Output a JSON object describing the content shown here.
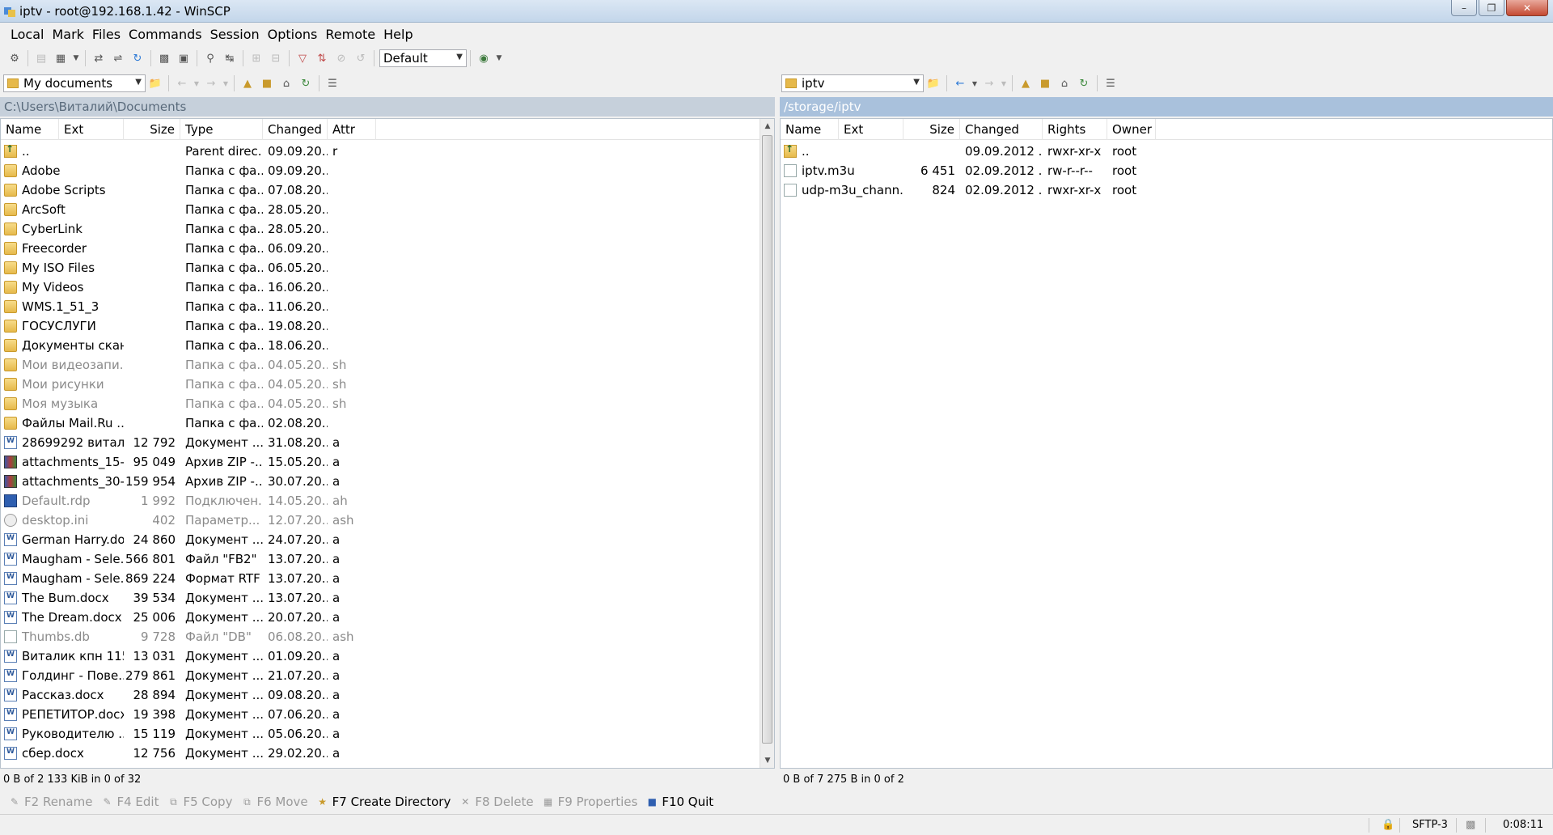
{
  "window": {
    "title": "iptv - root@192.168.1.42 - WinSCP"
  },
  "menu": [
    {
      "label": "Local"
    },
    {
      "label": "Mark"
    },
    {
      "label": "Files"
    },
    {
      "label": "Commands"
    },
    {
      "label": "Session"
    },
    {
      "label": "Options"
    },
    {
      "label": "Remote"
    },
    {
      "label": "Help"
    }
  ],
  "toolbar": {
    "profile_value": "Default"
  },
  "left": {
    "location": "My documents",
    "path": "C:\\Users\\Виталий\\Documents",
    "columns": [
      "Name",
      "Ext",
      "Size",
      "Type",
      "Changed",
      "Attr"
    ],
    "rows": [
      {
        "name": "..",
        "size": "",
        "type": "Parent direc...",
        "changed": "09.09.20...",
        "attr": "r",
        "icon": "up-folder-icon"
      },
      {
        "name": "Adobe",
        "size": "",
        "type": "Папка с фа...",
        "changed": "09.09.20...",
        "attr": "",
        "icon": "folder-icon"
      },
      {
        "name": "Adobe Scripts",
        "size": "",
        "type": "Папка с фа...",
        "changed": "07.08.20...",
        "attr": "",
        "icon": "folder-icon"
      },
      {
        "name": "ArcSoft",
        "size": "",
        "type": "Папка с фа...",
        "changed": "28.05.20...",
        "attr": "",
        "icon": "folder-icon"
      },
      {
        "name": "CyberLink",
        "size": "",
        "type": "Папка с фа...",
        "changed": "28.05.20...",
        "attr": "",
        "icon": "folder-icon"
      },
      {
        "name": "Freecorder",
        "size": "",
        "type": "Папка с фа...",
        "changed": "06.09.20...",
        "attr": "",
        "icon": "folder-icon"
      },
      {
        "name": "My ISO Files",
        "size": "",
        "type": "Папка с фа...",
        "changed": "06.05.20...",
        "attr": "",
        "icon": "folder-icon"
      },
      {
        "name": "My Videos",
        "size": "",
        "type": "Папка с фа...",
        "changed": "16.06.20...",
        "attr": "",
        "icon": "folder-icon"
      },
      {
        "name": "WMS.1_51_3",
        "size": "",
        "type": "Папка с фа...",
        "changed": "11.06.20...",
        "attr": "",
        "icon": "folder-icon"
      },
      {
        "name": "ГОСУСЛУГИ",
        "size": "",
        "type": "Папка с фа...",
        "changed": "19.08.20...",
        "attr": "",
        "icon": "folder-icon"
      },
      {
        "name": "Документы скан...",
        "size": "",
        "type": "Папка с фа...",
        "changed": "18.06.20...",
        "attr": "",
        "icon": "folder-icon"
      },
      {
        "name": "Мои видеозапи...",
        "size": "",
        "type": "Папка с фа...",
        "changed": "04.05.20...",
        "attr": "sh",
        "icon": "folder-icon",
        "hidden": true
      },
      {
        "name": "Мои рисунки",
        "size": "",
        "type": "Папка с фа...",
        "changed": "04.05.20...",
        "attr": "sh",
        "icon": "folder-icon",
        "hidden": true
      },
      {
        "name": "Моя музыка",
        "size": "",
        "type": "Папка с фа...",
        "changed": "04.05.20...",
        "attr": "sh",
        "icon": "folder-icon",
        "hidden": true
      },
      {
        "name": "Файлы Mail.Ru ...",
        "size": "",
        "type": "Папка с фа...",
        "changed": "02.08.20...",
        "attr": "",
        "icon": "folder-icon"
      },
      {
        "name": "28699292 витал...",
        "size": "12 792",
        "type": "Документ ...",
        "changed": "31.08.20...",
        "attr": "a",
        "icon": "word-doc-icon"
      },
      {
        "name": "attachments_15-...",
        "size": "95 049",
        "type": "Архив ZIP -...",
        "changed": "15.05.20...",
        "attr": "a",
        "icon": "zip-archive-icon"
      },
      {
        "name": "attachments_30-...",
        "size": "159 954",
        "type": "Архив ZIP -...",
        "changed": "30.07.20...",
        "attr": "a",
        "icon": "zip-archive-icon"
      },
      {
        "name": "Default.rdp",
        "size": "1 992",
        "type": "Подключен...",
        "changed": "14.05.20...",
        "attr": "ah",
        "icon": "rdp-file-icon",
        "hidden": true
      },
      {
        "name": "desktop.ini",
        "size": "402",
        "type": "Параметр...",
        "changed": "12.07.20...",
        "attr": "ash",
        "icon": "settings-file-icon",
        "hidden": true
      },
      {
        "name": "German Harry.do...",
        "size": "24 860",
        "type": "Документ ...",
        "changed": "24.07.20...",
        "attr": "a",
        "icon": "word-doc-icon"
      },
      {
        "name": "Maugham - Sele...",
        "size": "566 801",
        "type": "Файл \"FB2\"",
        "changed": "13.07.20...",
        "attr": "a",
        "icon": "word-doc-icon"
      },
      {
        "name": "Maugham - Sele...",
        "size": "869 224",
        "type": "Формат RTF",
        "changed": "13.07.20...",
        "attr": "a",
        "icon": "word-doc-icon"
      },
      {
        "name": "The Bum.docx",
        "size": "39 534",
        "type": "Документ ...",
        "changed": "13.07.20...",
        "attr": "a",
        "icon": "word-doc-icon"
      },
      {
        "name": "The Dream.docx",
        "size": "25 006",
        "type": "Документ ...",
        "changed": "20.07.20...",
        "attr": "a",
        "icon": "word-doc-icon"
      },
      {
        "name": "Thumbs.db",
        "size": "9 728",
        "type": "Файл \"DB\"",
        "changed": "06.08.20...",
        "attr": "ash",
        "icon": "db-file-icon",
        "hidden": true
      },
      {
        "name": "Виталик кпн 115...",
        "size": "13 031",
        "type": "Документ ...",
        "changed": "01.09.20...",
        "attr": "a",
        "icon": "word-doc-icon"
      },
      {
        "name": "Голдинг - Пове...",
        "size": "279 861",
        "type": "Документ ...",
        "changed": "21.07.20...",
        "attr": "a",
        "icon": "word-doc-icon"
      },
      {
        "name": "Рассказ.docx",
        "size": "28 894",
        "type": "Документ ...",
        "changed": "09.08.20...",
        "attr": "a",
        "icon": "word-doc-icon"
      },
      {
        "name": "РЕПЕТИТОР.docx",
        "size": "19 398",
        "type": "Документ ...",
        "changed": "07.06.20...",
        "attr": "a",
        "icon": "word-doc-icon"
      },
      {
        "name": "Руководителю ...",
        "size": "15 119",
        "type": "Документ ...",
        "changed": "05.06.20...",
        "attr": "a",
        "icon": "word-doc-icon"
      },
      {
        "name": "сбер.docx",
        "size": "12 756",
        "type": "Документ ...",
        "changed": "29.02.20...",
        "attr": "a",
        "icon": "word-doc-icon"
      }
    ],
    "status": "0 B of 2 133 KiB in 0 of 32"
  },
  "right": {
    "location": "iptv",
    "path": "/storage/iptv",
    "columns": [
      "Name",
      "Ext",
      "Size",
      "Changed",
      "Rights",
      "Owner"
    ],
    "rows": [
      {
        "name": "..",
        "size": "",
        "changed": "09.09.2012 ...",
        "rights": "rwxr-xr-x",
        "owner": "root",
        "icon": "up-folder-icon"
      },
      {
        "name": "iptv.m3u",
        "size": "6 451",
        "changed": "02.09.2012 ...",
        "rights": "rw-r--r--",
        "owner": "root",
        "icon": "file-icon"
      },
      {
        "name": "udp-m3u_chann...",
        "size": "824",
        "changed": "02.09.2012 ...",
        "rights": "rwxr-xr-x",
        "owner": "root",
        "icon": "file-icon"
      }
    ],
    "status": "0 B of 7 275 B in 0 of 2"
  },
  "fkeys": [
    {
      "label": "F2 Rename",
      "enabled": false
    },
    {
      "label": "F4 Edit",
      "enabled": false
    },
    {
      "label": "F5 Copy",
      "enabled": false
    },
    {
      "label": "F6 Move",
      "enabled": false
    },
    {
      "label": "F7 Create Directory",
      "enabled": true
    },
    {
      "label": "F8 Delete",
      "enabled": false
    },
    {
      "label": "F9 Properties",
      "enabled": false
    },
    {
      "label": "F10 Quit",
      "enabled": true
    }
  ],
  "statusbar": {
    "protocol": "SFTP-3",
    "time": "0:08:11"
  }
}
